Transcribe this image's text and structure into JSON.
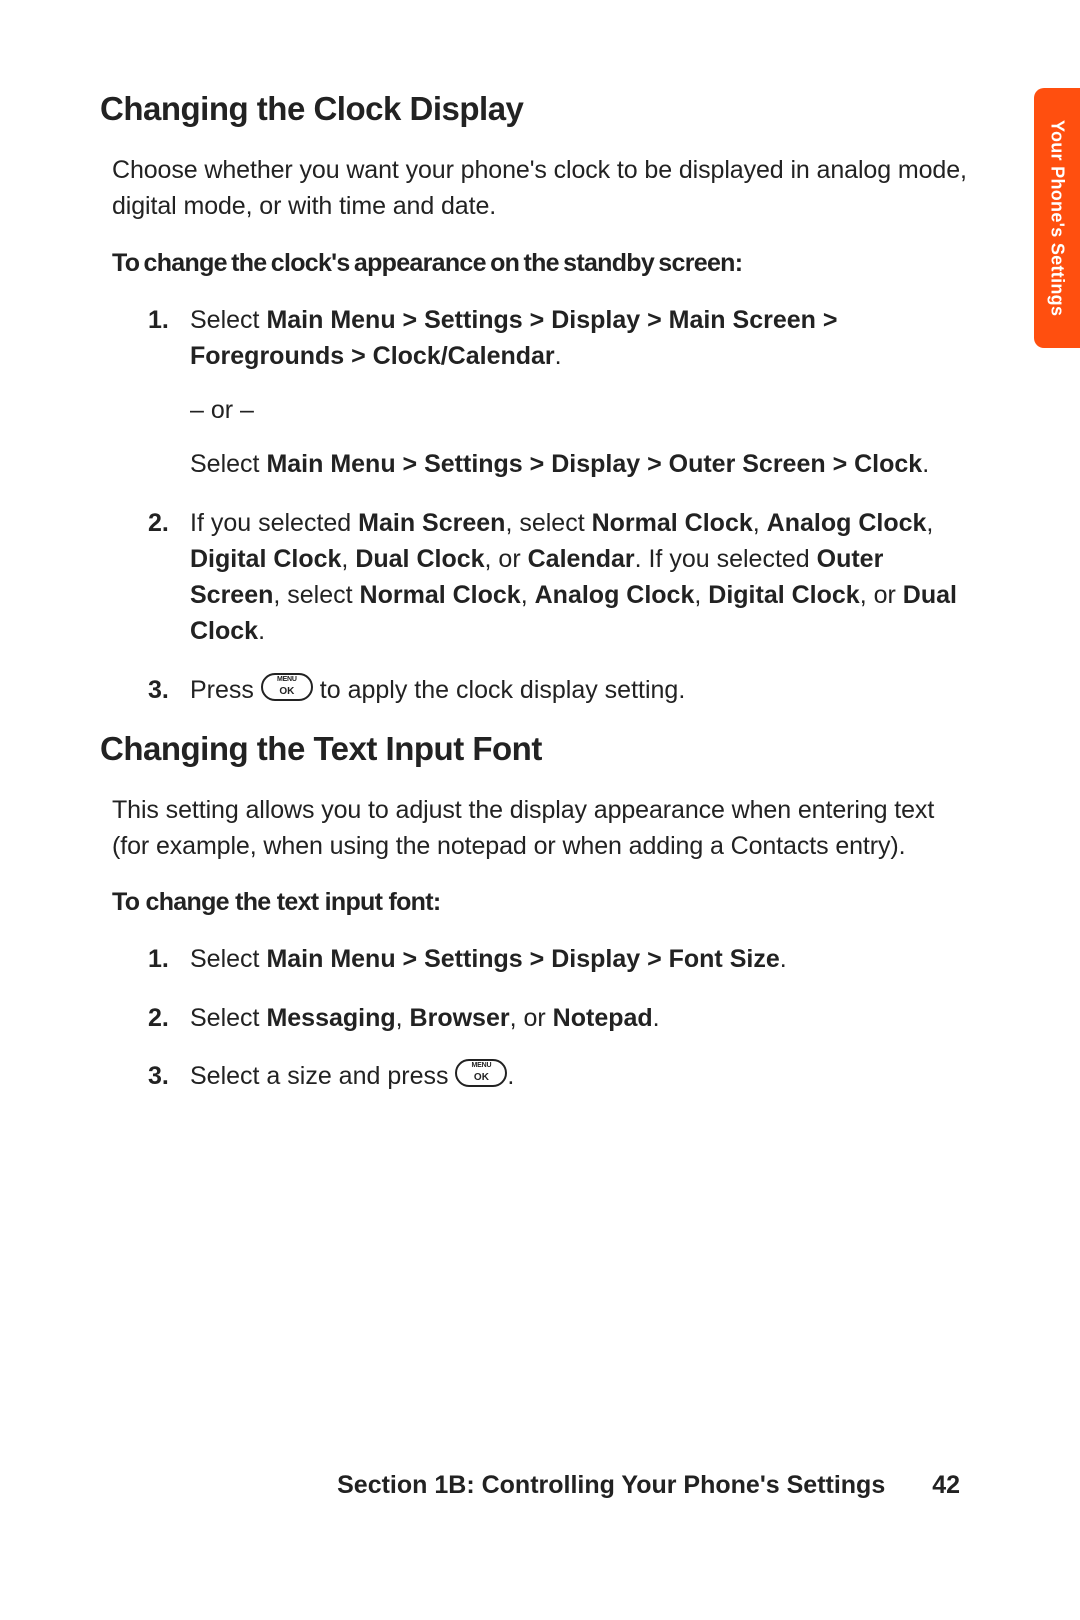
{
  "tab": {
    "label": "Your Phone's Settings"
  },
  "section1": {
    "heading": "Changing the Clock Display",
    "intro": "Choose whether you want your phone's clock to be displayed in analog mode, digital mode, or with time and date.",
    "subhead": "To change the clock's appearance on the standby screen:",
    "step1_pre": "Select ",
    "step1_bold": "Main Menu > Settings > Display > Main Screen > Foregrounds > Clock/Calendar",
    "step1_post": ".",
    "or_text": "– or –",
    "step1b_pre": "Select ",
    "step1b_bold": "Main Menu > Settings > Display > Outer Screen > Clock",
    "step1b_post": ".",
    "step2_a": "If you selected ",
    "step2_b": "Main Screen",
    "step2_c": ", select ",
    "step2_d": "Normal Clock",
    "step2_e": ", ",
    "step2_f": "Analog Clock",
    "step2_g": ", ",
    "step2_h": "Digital Clock",
    "step2_i": ", ",
    "step2_j": "Dual Clock",
    "step2_k": ", or ",
    "step2_l": "Calendar",
    "step2_m": ". If you selected ",
    "step2_n": "Outer Screen",
    "step2_o": ", select ",
    "step2_p": "Normal Clock",
    "step2_q": ", ",
    "step2_r": "Analog Clock",
    "step2_s": ", ",
    "step2_t": "Digital Clock",
    "step2_u": ", or ",
    "step2_v": "Dual Clock",
    "step2_w": ".",
    "step3_pre": "Press ",
    "step3_post": " to apply the clock display setting."
  },
  "section2": {
    "heading": "Changing the Text Input Font",
    "intro": "This setting allows you to adjust the display appearance when entering text (for example, when using the notepad or when adding a Contacts entry).",
    "subhead": "To change the text input font:",
    "step1_pre": "Select ",
    "step1_bold": "Main Menu > Settings > Display > Font Size",
    "step1_post": ".",
    "step2_pre": "Select ",
    "step2_b1": "Messaging",
    "step2_s1": ", ",
    "step2_b2": "Browser",
    "step2_s2": ", or ",
    "step2_b3": "Notepad",
    "step2_post": ".",
    "step3_pre": "Select a size and press ",
    "step3_post": "."
  },
  "footer": {
    "section_label": "Section 1B: Controlling Your Phone's Settings",
    "page_number": "42"
  }
}
